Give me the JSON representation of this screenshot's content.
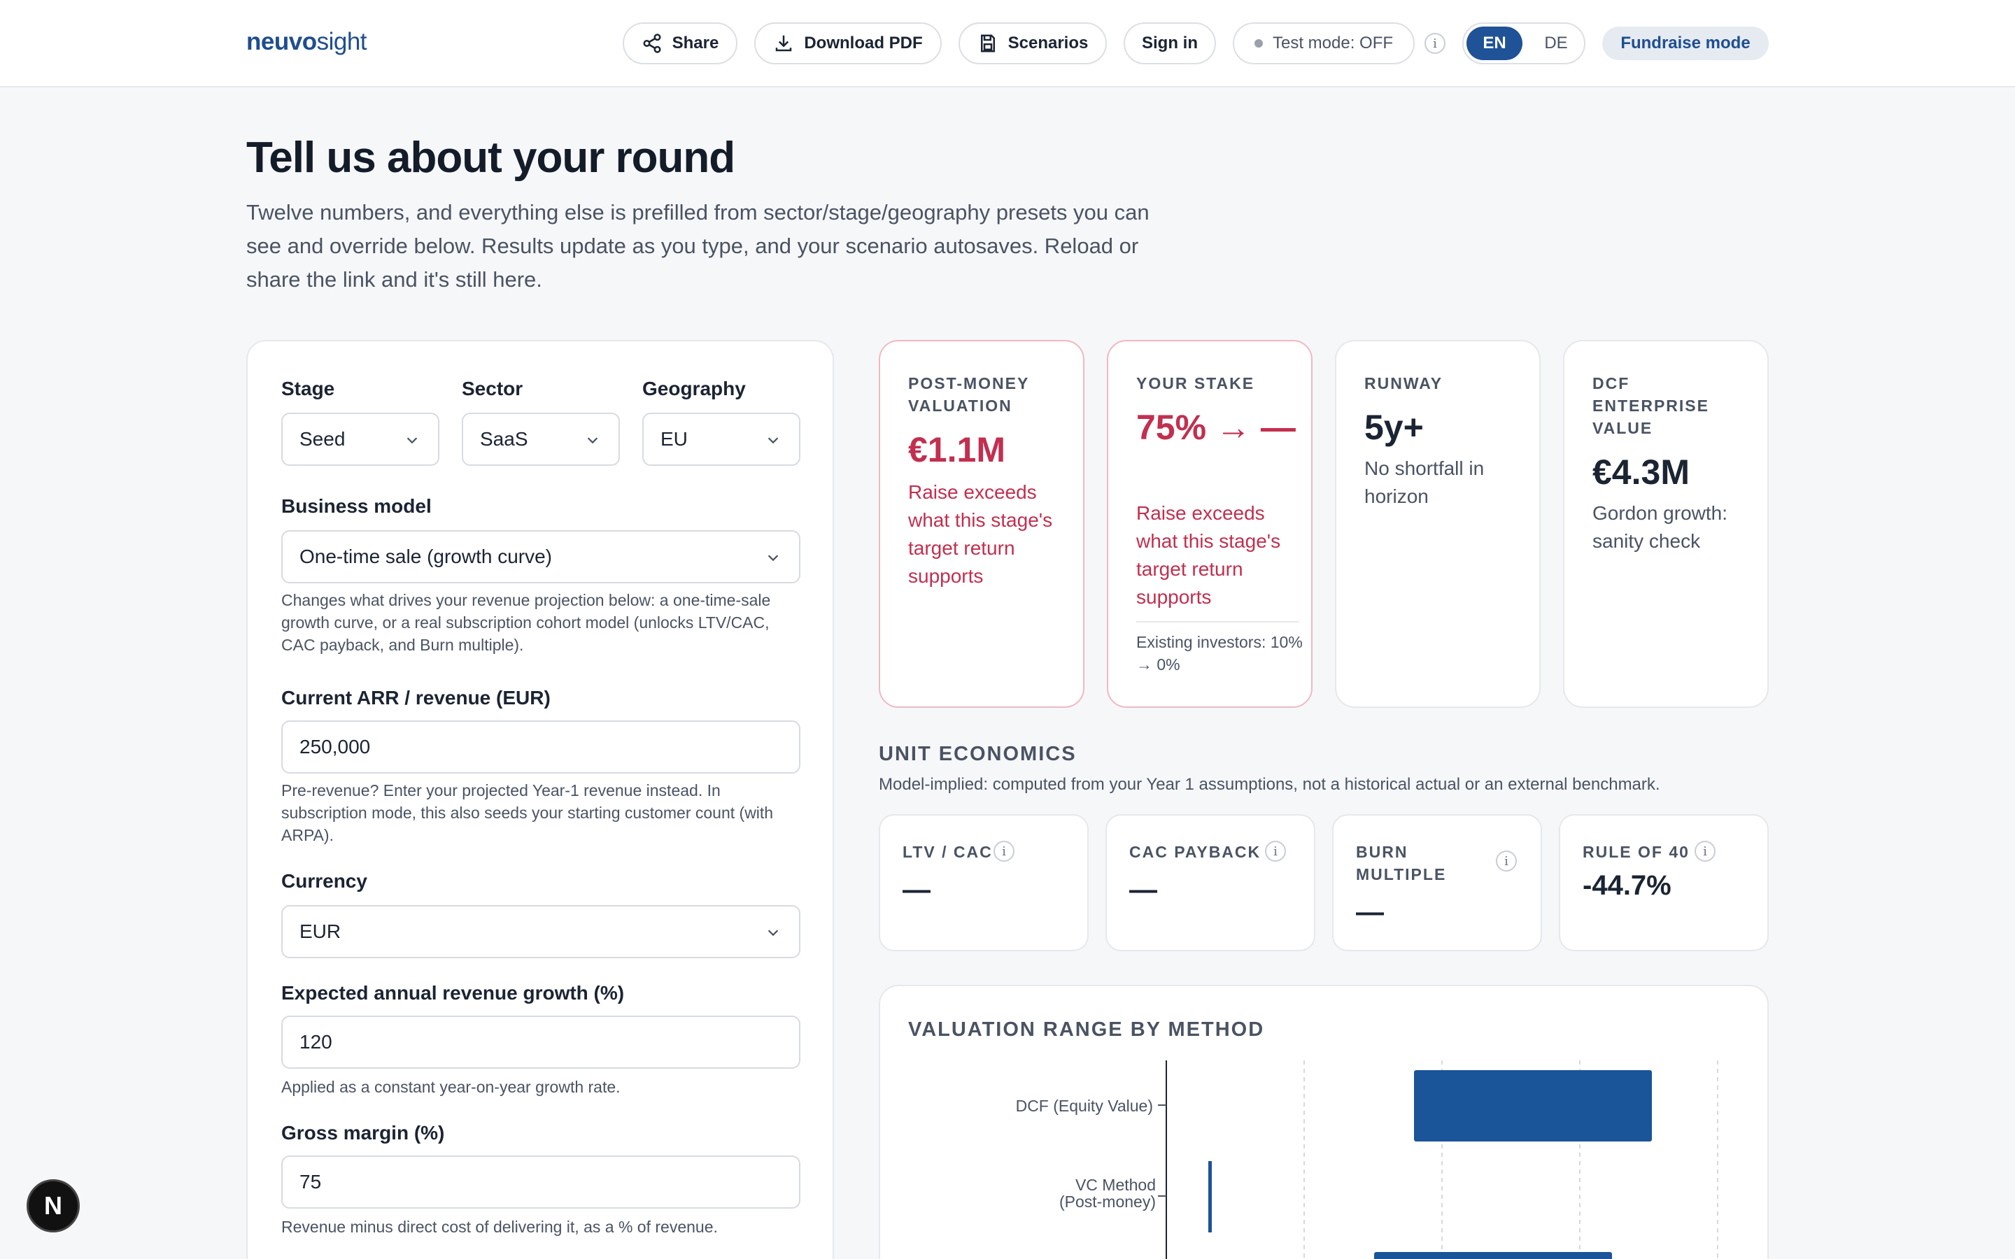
{
  "header": {
    "logo_part1": "neuvo",
    "logo_part2": "sight",
    "share_label": "Share",
    "download_label": "Download PDF",
    "scenarios_label": "Scenarios",
    "signin_label": "Sign in",
    "testmode_label": "Test mode: OFF",
    "info_glyph": "i",
    "lang_en": "EN",
    "lang_de": "DE",
    "fundraise_label": "Fundraise mode"
  },
  "hero": {
    "title": "Tell us about your round",
    "subtitle": "Twelve numbers, and everything else is prefilled from sector/stage/geography presets you can see and override below. Results update as you type, and your scenario autosaves. Reload or share the link and it's still here."
  },
  "form": {
    "stage_label": "Stage",
    "stage_value": "Seed",
    "sector_label": "Sector",
    "sector_value": "SaaS",
    "geo_label": "Geography",
    "geo_value": "EU",
    "bm_label": "Business model",
    "bm_value": "One-time sale (growth curve)",
    "bm_help": "Changes what drives your revenue projection below: a one-time-sale growth curve, or a real subscription cohort model (unlocks LTV/CAC, CAC payback, and Burn multiple).",
    "arr_label": "Current ARR / revenue (EUR)",
    "arr_value": "250,000",
    "arr_help": "Pre-revenue? Enter your projected Year-1 revenue instead. In subscription mode, this also seeds your starting customer count (with ARPA).",
    "currency_label": "Currency",
    "currency_value": "EUR",
    "growth_label": "Expected annual revenue growth (%)",
    "growth_value": "120",
    "growth_help": "Applied as a constant year-on-year growth rate.",
    "gm_label": "Gross margin (%)",
    "gm_value": "75",
    "gm_help": "Revenue minus direct cost of delivering it, as a % of revenue."
  },
  "kpis": {
    "post_money_title": "POST-MONEY VALUATION",
    "post_money_value": "€1.1M",
    "post_money_note": "Raise exceeds what this stage's target return supports",
    "stake_title": "YOUR STAKE",
    "stake_value": "75% → —",
    "stake_note": "Raise exceeds what this stage's target return supports",
    "stake_existing": "Existing investors: 10% → 0%",
    "runway_title": "RUNWAY",
    "runway_value": "5y+",
    "runway_note": "No shortfall in horizon",
    "dcf_title": "DCF ENTERPRISE VALUE",
    "dcf_value": "€4.3M",
    "dcf_note": "Gordon growth: sanity check"
  },
  "unit_economics": {
    "title": "UNIT ECONOMICS",
    "subtitle": "Model-implied: computed from your Year 1 assumptions, not a historical actual or an external benchmark.",
    "ltv_title": "LTV / CAC",
    "ltv_value": "—",
    "payback_title": "CAC PAYBACK",
    "payback_value": "—",
    "burn_title": "BURN MULTIPLE",
    "burn_value": "—",
    "rule40_title": "RULE OF 40",
    "rule40_value": "-44.7%"
  },
  "chart": {
    "title": "VALUATION RANGE BY METHOD",
    "label_dcf": "DCF (Equity Value)",
    "label_vc_line1": "VC Method",
    "label_vc_line2": "(Post-money)"
  },
  "colors": {
    "brand": "#1f4e8f",
    "accent_bar": "#1a5499",
    "alert": "#c22f4f"
  },
  "floating": {
    "glyph": "N"
  }
}
